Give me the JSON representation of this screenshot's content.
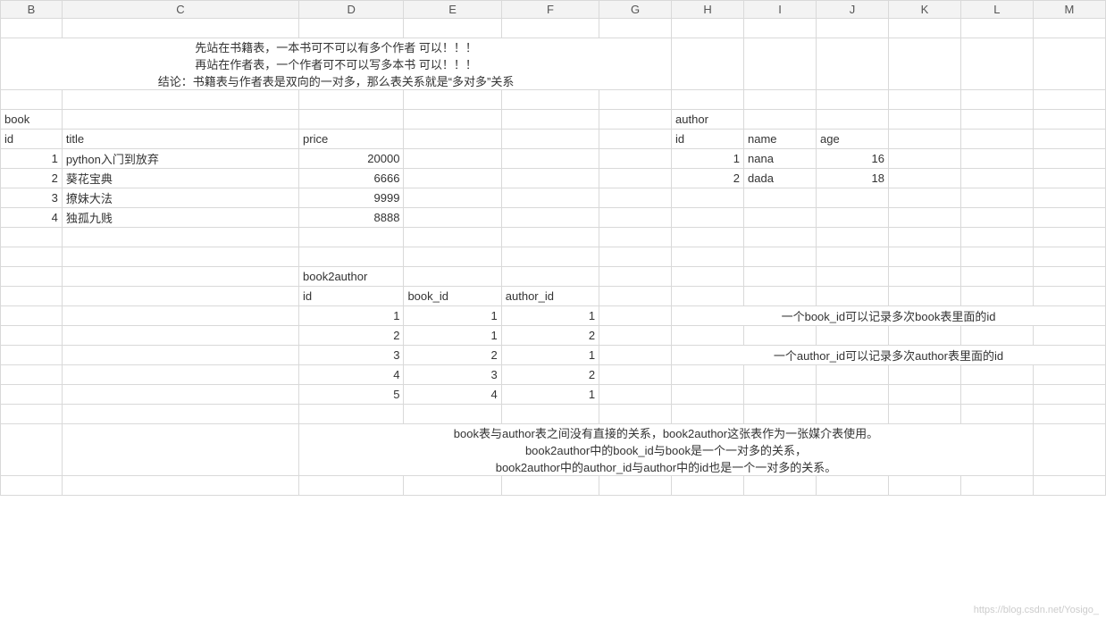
{
  "columns": [
    "B",
    "C",
    "D",
    "E",
    "F",
    "G",
    "H",
    "I",
    "J",
    "K",
    "L",
    "M"
  ],
  "intro": {
    "line1": "先站在书籍表，一本书可不可以有多个作者   可以！！！",
    "line2": "再站在作者表，一个作者可不可以写多本书   可以！！！",
    "line3": "结论：书籍表与作者表是双向的一对多，那么表关系就是“多对多”关系"
  },
  "book": {
    "label": "book",
    "headers": {
      "id": "id",
      "title": "title",
      "price": "price"
    },
    "rows": [
      {
        "id": "1",
        "title": "python入门到放弃",
        "price": "20000"
      },
      {
        "id": "2",
        "title": "葵花宝典",
        "price": "6666"
      },
      {
        "id": "3",
        "title": "撩妹大法",
        "price": "9999"
      },
      {
        "id": "4",
        "title": "独孤九贱",
        "price": "8888"
      }
    ]
  },
  "author": {
    "label": "author",
    "headers": {
      "id": "id",
      "name": "name",
      "age": "age"
    },
    "rows": [
      {
        "id": "1",
        "name": "nana",
        "age": "16"
      },
      {
        "id": "2",
        "name": "dada",
        "age": "18"
      }
    ]
  },
  "book2author": {
    "label": "book2author",
    "headers": {
      "id": "id",
      "book_id": "book_id",
      "author_id": "author_id"
    },
    "rows": [
      {
        "id": "1",
        "book_id": "1",
        "author_id": "1"
      },
      {
        "id": "2",
        "book_id": "1",
        "author_id": "2"
      },
      {
        "id": "3",
        "book_id": "2",
        "author_id": "1"
      },
      {
        "id": "4",
        "book_id": "3",
        "author_id": "2"
      },
      {
        "id": "5",
        "book_id": "4",
        "author_id": "1"
      }
    ]
  },
  "notes": {
    "n1": "一个book_id可以记录多次book表里面的id",
    "n2": "一个author_id可以记录多次author表里面的id"
  },
  "summary": {
    "s1": "book表与author表之间没有直接的关系，book2author这张表作为一张媒介表使用。",
    "s2": "book2author中的book_id与book是一个一对多的关系，",
    "s3": "book2author中的author_id与author中的id也是一个一对多的关系。"
  },
  "watermark": "https://blog.csdn.net/Yosigo_"
}
